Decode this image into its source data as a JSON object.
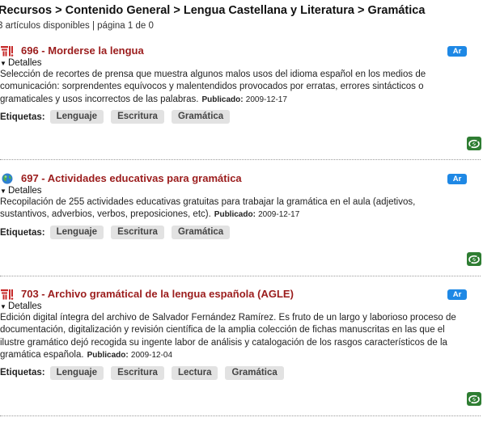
{
  "header": {
    "breadcrumb": "Recursos > Contenido General > Lengua Castellana y Literatura > Gramática",
    "summary": "3 artículos disponibles | página 1 de 0"
  },
  "articles": [
    {
      "title": "696 - Morderse la lengua",
      "icon": "cervantes-logo-icon",
      "lang": "Ar",
      "details_label": "Detalles",
      "description": "Selección de recortes de prensa que muestra algunos malos usos del idioma español en los medios de comunicación: sorprendentes equívocos y malentendidos provocados por erratas, errores sintácticos o gramaticales y usos incorrectos de las palabras.",
      "published_label": "Publicado:",
      "published_date": "2009-12-17",
      "tags_label": "Etiquetas:",
      "tags": [
        "Lenguaje",
        "Escritura",
        "Gramática"
      ]
    },
    {
      "title": "697 - Actividades educativas para gramática",
      "icon": "globe-icon",
      "lang": "Ar",
      "details_label": "Detalles",
      "description": "Recopilación de 255 actividades educativas gratuitas para trabajar la gramática en el aula (adjetivos, sustantivos, adverbios, verbos, preposiciones, etc).",
      "published_label": "Publicado:",
      "published_date": "2009-12-17",
      "tags_label": "Etiquetas:",
      "tags": [
        "Lenguaje",
        "Escritura",
        "Gramática"
      ]
    },
    {
      "title": "703 - Archivo gramátical de la lengua española (AGLE)",
      "icon": "cervantes-logo-icon",
      "lang": "Ar",
      "details_label": "Detalles",
      "description": "Edición digital íntegra del archivo de Salvador Fernández Ramírez. Es fruto de un largo y laborioso proceso de documentación, digitalización y revisión científica de la amplia colección de fichas manuscritas en las que el ilustre gramático dejó recogida su ingente labor de análisis y catalogación de los rasgos característicos de la gramática española.",
      "published_label": "Publicado:",
      "published_date": "2009-12-04",
      "tags_label": "Etiquetas:",
      "tags": [
        "Lenguaje",
        "Escritura",
        "Lectura",
        "Gramática"
      ]
    }
  ],
  "colors": {
    "title": "#9b1c1c",
    "lang_badge": "#1e88e5",
    "share_button": "#2e7d32",
    "tag_bg": "#e2e2e2"
  },
  "icons": {
    "share": "share-icon"
  }
}
